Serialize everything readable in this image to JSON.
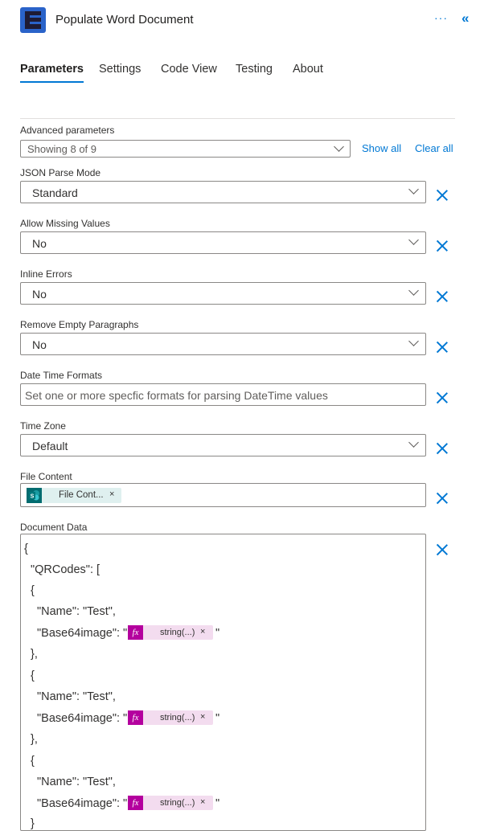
{
  "header": {
    "title": "Populate Word Document",
    "more_label": "···",
    "collapse_label": "«"
  },
  "tabs": [
    {
      "label": "Parameters"
    },
    {
      "label": "Settings"
    },
    {
      "label": "Code View"
    },
    {
      "label": "Testing"
    },
    {
      "label": "About"
    }
  ],
  "advanced": {
    "label": "Advanced parameters",
    "value": "Showing 8 of 9",
    "show_all": "Show all",
    "clear_all": "Clear all"
  },
  "params": {
    "json_parse_mode": {
      "label": "JSON Parse Mode",
      "value": "Standard"
    },
    "allow_missing": {
      "label": "Allow Missing Values",
      "value": "No"
    },
    "inline_errors": {
      "label": "Inline Errors",
      "value": "No"
    },
    "remove_empty": {
      "label": "Remove Empty Paragraphs",
      "value": "No"
    },
    "date_time": {
      "label": "Date Time Formats",
      "placeholder": "Set one or more specfic formats for parsing DateTime values"
    },
    "time_zone": {
      "label": "Time Zone",
      "value": "Default"
    },
    "file_content": {
      "label": "File Content",
      "token": "File Cont...",
      "token_close": "×"
    }
  },
  "document": {
    "label": "Document Data",
    "lines": {
      "open": "{",
      "qrcodes": "\"QRCodes\": [",
      "obj_open": "{",
      "name": "\"Name\": \"Test\",",
      "base64_prefix": "\"Base64image\": \"",
      "base64_suffix": "\"",
      "obj_close_comma": "},",
      "obj_close": "}"
    },
    "func_token": {
      "icon": "fx",
      "text": "string(...)",
      "close": "×"
    }
  }
}
